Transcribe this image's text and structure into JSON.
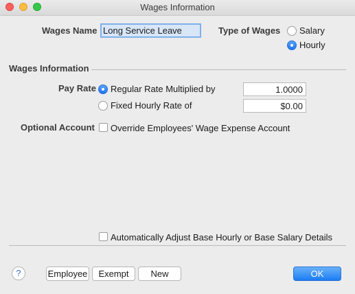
{
  "window": {
    "title": "Wages Information"
  },
  "wages_name": {
    "label": "Wages Name",
    "value": "Long Service Leave"
  },
  "type_of_wages": {
    "label": "Type of Wages",
    "options": [
      "Salary",
      "Hourly"
    ],
    "selected": "Hourly"
  },
  "wages_information": {
    "section_label": "Wages Information",
    "pay_rate": {
      "label": "Pay Rate",
      "options": [
        {
          "label": "Regular Rate Multiplied by",
          "value": "1.0000"
        },
        {
          "label": "Fixed Hourly Rate of",
          "value": "$0.00"
        }
      ],
      "selected": "Regular Rate Multiplied by"
    },
    "optional_account": {
      "label": "Optional Account",
      "override_label": "Override Employees' Wage Expense Account",
      "override_checked": false
    }
  },
  "auto_adjust": {
    "label": "Automatically Adjust Base Hourly or Base Salary Details",
    "checked": false
  },
  "buttons": {
    "help": "?",
    "employee": "Employee",
    "exempt": "Exempt",
    "new": "New",
    "ok": "OK"
  },
  "colors": {
    "accent": "#1f74f0",
    "window_bg": "#ececec"
  }
}
